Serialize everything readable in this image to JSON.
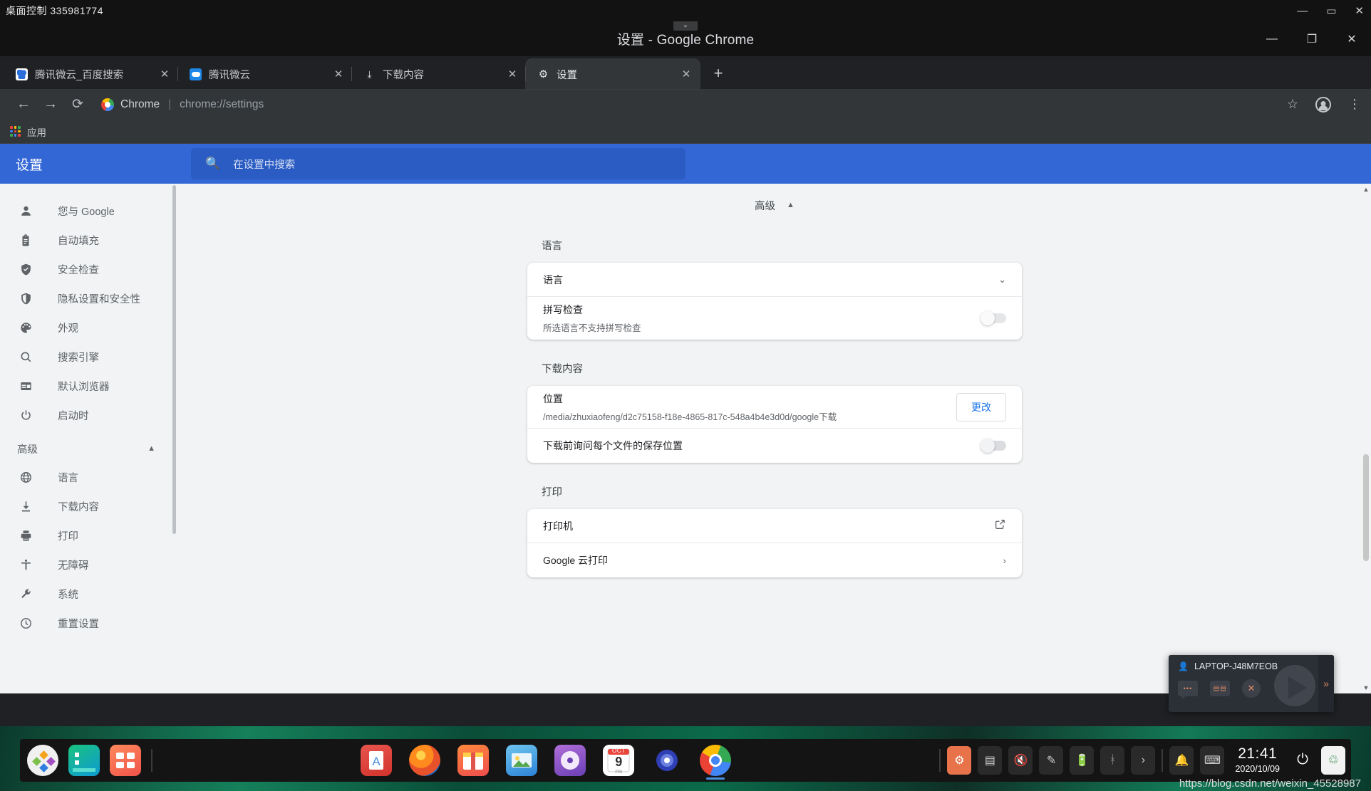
{
  "remote": {
    "title": "桌面控制 335981774",
    "window_controls": [
      "—",
      "▭",
      "✕"
    ]
  },
  "chrome": {
    "window_title": "设置 - Google Chrome",
    "window_controls": [
      "—",
      "❐",
      "✕"
    ],
    "tabs": [
      {
        "title": "腾讯微云_百度搜索",
        "icon": "baidu-favicon",
        "active": false,
        "close": "✕"
      },
      {
        "title": "腾讯微云",
        "icon": "weiyun-favicon",
        "active": false,
        "close": "✕"
      },
      {
        "title": "下载内容",
        "icon": "download-favicon",
        "active": false,
        "close": "✕"
      },
      {
        "title": "设置",
        "icon": "gear-favicon",
        "active": true,
        "close": "✕"
      }
    ],
    "new_tab_label": "+",
    "toolbar": {
      "back": "←",
      "forward": "→",
      "reload": "⟳",
      "omnibox_scheme": "Chrome",
      "omnibox_separator": "|",
      "omnibox_url": "chrome://settings",
      "bookmark_star": "☆",
      "menu": "⋮"
    },
    "bookmarks": {
      "apps_label": "应用"
    }
  },
  "settings": {
    "header_title": "设置",
    "search_placeholder": "在设置中搜索",
    "sidebar": {
      "items": [
        {
          "label": "您与 Google",
          "icon": "person-icon"
        },
        {
          "label": "自动填充",
          "icon": "clipboard-icon"
        },
        {
          "label": "安全检查",
          "icon": "shield-check-icon"
        },
        {
          "label": "隐私设置和安全性",
          "icon": "shield-icon"
        },
        {
          "label": "外观",
          "icon": "palette-icon"
        },
        {
          "label": "搜索引擎",
          "icon": "search-icon"
        },
        {
          "label": "默认浏览器",
          "icon": "browser-window-icon"
        },
        {
          "label": "启动时",
          "icon": "power-icon"
        }
      ],
      "group_label": "高级",
      "group_arrow": "▲",
      "advanced_items": [
        {
          "label": "语言",
          "icon": "globe-icon"
        },
        {
          "label": "下载内容",
          "icon": "download-icon"
        },
        {
          "label": "打印",
          "icon": "printer-icon"
        },
        {
          "label": "无障碍",
          "icon": "accessibility-icon"
        },
        {
          "label": "系统",
          "icon": "wrench-icon"
        },
        {
          "label": "重置设置",
          "icon": "restore-icon"
        }
      ]
    },
    "main": {
      "advanced_toggle": {
        "label": "高级",
        "arrow": "▲"
      },
      "sections": [
        {
          "title": "语言",
          "rows": [
            {
              "label": "语言",
              "sub": "",
              "control": "chevron-down",
              "control_glyph": "⌄"
            },
            {
              "label": "拼写检查",
              "sub": "所选语言不支持拼写检查",
              "control": "toggle-off-disabled"
            }
          ]
        },
        {
          "title": "下载内容",
          "rows": [
            {
              "label": "位置",
              "sub": "/media/zhuxiaofeng/d2c75158-f18e-4865-817c-548a4b4e3d0d/google下载",
              "control": "button",
              "button_label": "更改"
            },
            {
              "label": "下载前询问每个文件的保存位置",
              "sub": "",
              "control": "toggle-off"
            }
          ]
        },
        {
          "title": "打印",
          "rows": [
            {
              "label": "打印机",
              "sub": "",
              "control": "external-link",
              "control_glyph": "↗"
            },
            {
              "label": "Google 云打印",
              "sub": "",
              "control": "chevron-right",
              "control_glyph": "›"
            }
          ]
        }
      ]
    }
  },
  "remote_panel": {
    "machine_name": "LAPTOP-J48M7EOB",
    "person_icon": "person-icon",
    "buttons": [
      "chat-icon",
      "keyboard-icon",
      "close-icon"
    ],
    "expand_glyph": "»"
  },
  "taskbar": {
    "left_icons": [
      "app-launcher-icon",
      "files-icon",
      "apps-grid-icon"
    ],
    "center_icons": [
      "text-editor-icon",
      "firefox-icon",
      "store-icon",
      "photos-icon",
      "music-icon",
      "calendar-icon",
      "settings-icon",
      "chrome-icon"
    ],
    "calendar": {
      "month": "OCT",
      "day": "9",
      "weekday": "FRI"
    },
    "tray_icons": [
      "updater-icon",
      "ime-icon",
      "volume-mute-icon",
      "pen-icon",
      "battery-icon",
      "bluetooth-icon",
      "expand-icon"
    ],
    "notification_icon": "bell-icon",
    "keyboard_icon": "keyboard-icon",
    "clock": {
      "time": "21:41",
      "date": "2020/10/09"
    },
    "power_icon": "power-icon",
    "trash_icon": "trash-icon",
    "watermark": "https://blog.csdn.net/weixin_45528987"
  }
}
